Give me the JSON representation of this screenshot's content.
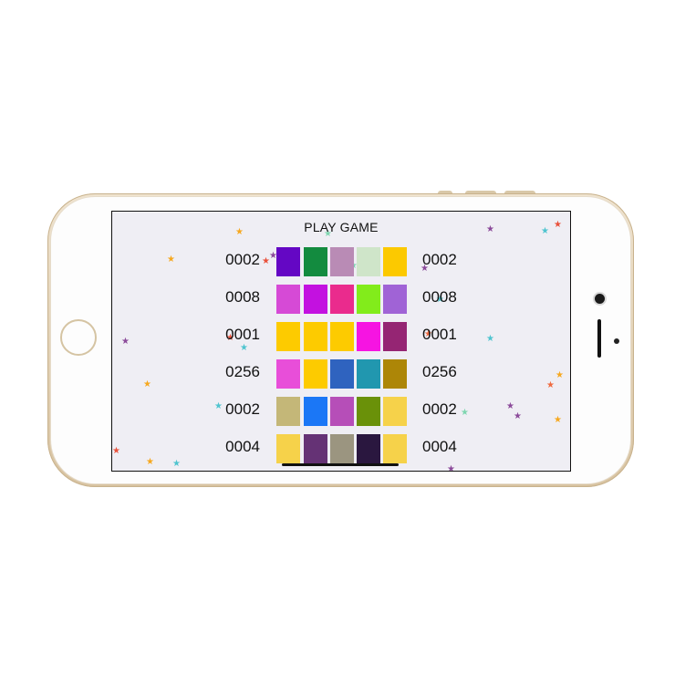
{
  "game": {
    "title": "PLAY GAME",
    "rows": [
      {
        "left_score": "0002",
        "right_score": "0002",
        "tiles": [
          "#6407c4",
          "#138b3f",
          "#b98bb5",
          "#cfe5c9",
          "#fcc900"
        ]
      },
      {
        "left_score": "0008",
        "right_score": "0008",
        "tiles": [
          "#d64ad6",
          "#c311e0",
          "#ea2b8d",
          "#82ec1b",
          "#a063d6"
        ]
      },
      {
        "left_score": "0001",
        "right_score": "0001",
        "tiles": [
          "#fdcb00",
          "#fdcb00",
          "#fdcb00",
          "#f614e2",
          "#952573"
        ]
      },
      {
        "left_score": "0256",
        "right_score": "0256",
        "tiles": [
          "#e84ed9",
          "#fdcb00",
          "#2f63bf",
          "#2197af",
          "#ad8607"
        ]
      },
      {
        "left_score": "0002",
        "right_score": "0002",
        "tiles": [
          "#c4b778",
          "#1b77f6",
          "#b64eb8",
          "#6a9109",
          "#f6d24a"
        ]
      },
      {
        "left_score": "0004",
        "right_score": "0004",
        "tiles": [
          "#f6d24a",
          "#653275",
          "#9b9580",
          "#2a173f",
          "#f6d24a"
        ]
      }
    ]
  },
  "decorations": {
    "star_icon": "star-icon",
    "star_colors": [
      "#f6a81f",
      "#e9513b",
      "#8b4a9a",
      "#4fc4cf",
      "#7fd6b0",
      "#ef6a3f"
    ]
  },
  "device": {
    "frame_color": "#e7d7bb",
    "screen_background": "#efeef4"
  }
}
